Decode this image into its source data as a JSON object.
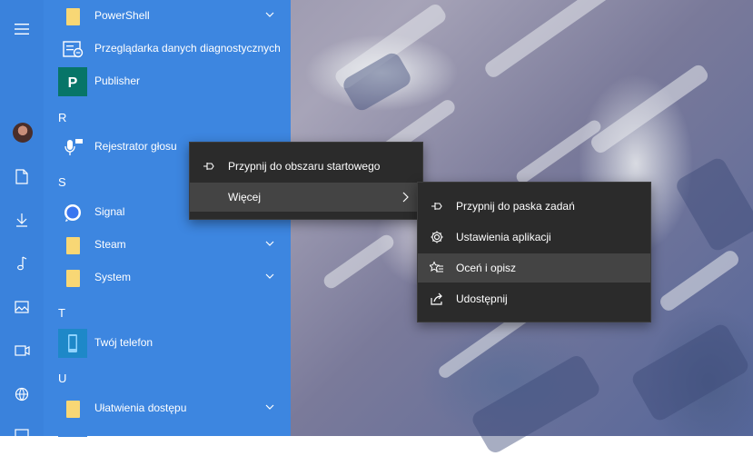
{
  "start_menu": {
    "groups": [
      {
        "letter": "R"
      },
      {
        "letter": "S"
      },
      {
        "letter": "T"
      },
      {
        "letter": "U"
      }
    ],
    "apps": {
      "powershell": "PowerShell",
      "diag": "Przeglądarka danych diagnostycznych",
      "publisher": "Publisher",
      "recorder": "Rejestrator głosu",
      "signal": "Signal",
      "steam": "Steam",
      "system": "System",
      "phone": "Twój telefon",
      "ease": "Ułatwienia dostępu"
    },
    "rail_icons": [
      "hamburger-icon",
      "avatar",
      "document-icon",
      "download-icon",
      "music-icon",
      "pictures-icon",
      "video-icon",
      "network-icon",
      "power-icon"
    ]
  },
  "context_menu": {
    "pin_start": "Przypnij do obszaru startowego",
    "more": "Więcej"
  },
  "submenu": {
    "pin_taskbar": "Przypnij do paska zadań",
    "app_settings": "Ustawienia aplikacji",
    "rate_review": "Oceń i opisz",
    "share": "Udostępnij"
  },
  "colors": {
    "start_bg": "#3d86e0",
    "menu_bg": "#2b2b2b",
    "menu_hover": "#444444",
    "folder": "#f8d775",
    "publisher": "#077568",
    "signal": "#3a76f0",
    "phone": "#1e88c8"
  }
}
